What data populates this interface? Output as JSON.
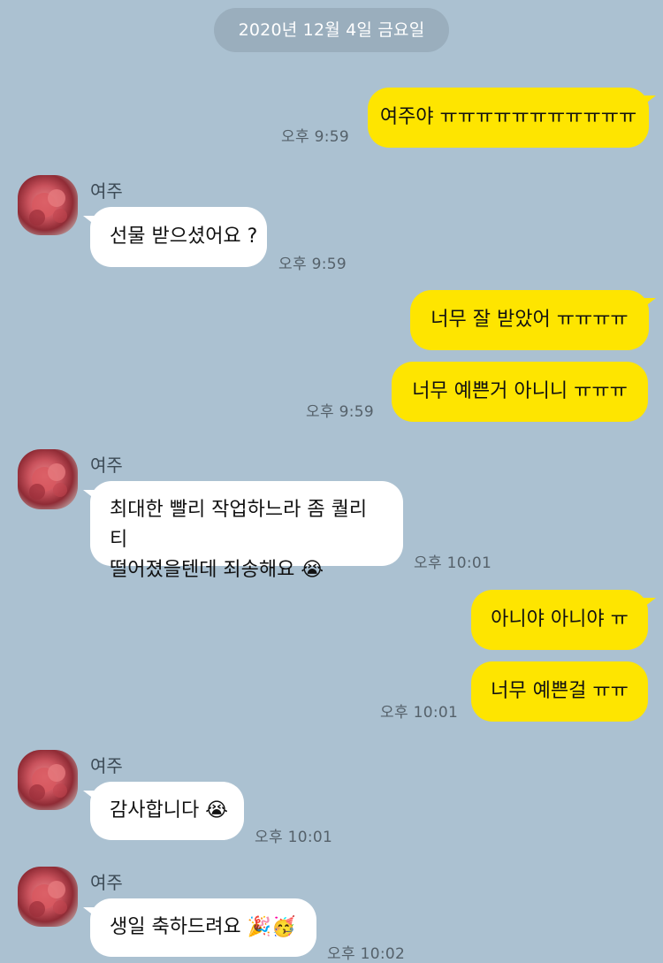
{
  "date_label": "2020년 12월 4일 금요일",
  "sender_name": "여주",
  "messages": [
    {
      "from": "me",
      "text": "여주야 ㅠㅠㅠㅠㅠㅠㅠㅠㅠㅠㅠ",
      "time": "오후 9:59"
    },
    {
      "from": "other",
      "text": "선물 받으셨어요 ?",
      "time": "오후 9:59"
    },
    {
      "from": "me",
      "text": "너무 잘 받았어 ㅠㅠㅠㅠ",
      "time": ""
    },
    {
      "from": "me",
      "text": "너무 예쁜거 아니니 ㅠㅠㅠ",
      "time": "오후 9:59"
    },
    {
      "from": "other",
      "line1": "최대한 빨리 작업하느라 좀 퀄리티",
      "line2": "떨어졌을텐데 죄송해요",
      "emoji": "😭",
      "time": "오후 10:01"
    },
    {
      "from": "me",
      "text": "아니야 아니야 ㅠ",
      "time": ""
    },
    {
      "from": "me",
      "text": "너무 예쁜걸 ㅠㅠ",
      "time": "오후 10:01"
    },
    {
      "from": "other",
      "text": "감사합니다",
      "emoji": "😭",
      "time": "오후 10:01"
    },
    {
      "from": "other",
      "text": "생일 축하드려요",
      "emoji": "🎉🥳",
      "time": "오후 10:02"
    }
  ],
  "colors": {
    "background": "#abc1d1",
    "my_bubble": "#fee500",
    "other_bubble": "#ffffff"
  }
}
